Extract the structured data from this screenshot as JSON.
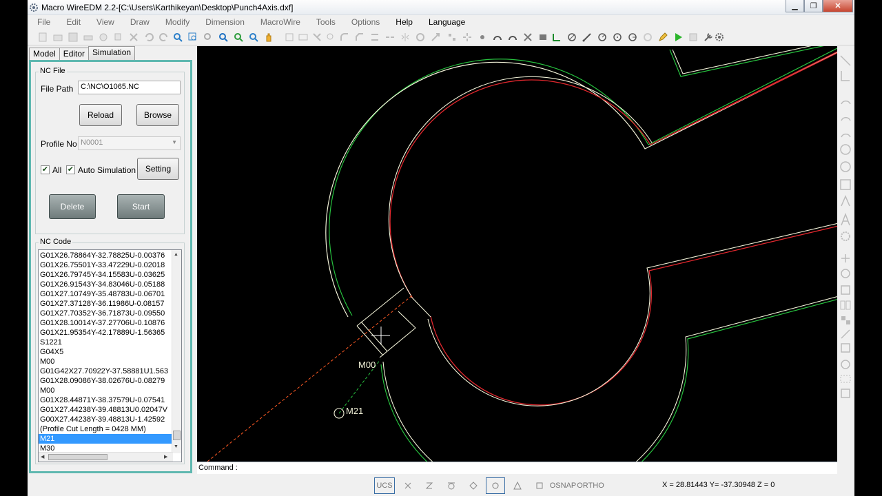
{
  "window": {
    "title": "Macro WireEDM 2.2-[C:\\Users\\Karthikeyan\\Desktop\\Punch4Axis.dxf]",
    "minimize": "▁",
    "restore": "❐",
    "close": "✕"
  },
  "menu": [
    "File",
    "Edit",
    "View",
    "Draw",
    "Modify",
    "Dimension",
    "MacroWire",
    "Tools",
    "Options",
    "Help",
    "Language"
  ],
  "tabs": {
    "model": "Model",
    "editor": "Editor",
    "simulation": "Simulation"
  },
  "nc_file": {
    "group_title": "NC File",
    "file_path_label": "File Path",
    "file_path_value": "C:\\NC\\O1065.NC",
    "reload": "Reload",
    "browse": "Browse",
    "profile_no_label": "Profile No",
    "profile_no_value": "N0001",
    "all_label": "All",
    "auto_sim_label": "Auto Simulation",
    "setting": "Setting",
    "delete": "Delete",
    "start": "Start"
  },
  "nc_code": {
    "group_title": "NC Code",
    "lines": [
      "G01X26.78864Y-32.78825U-0.00376",
      "G01X26.75501Y-33.47229U-0.02018",
      "G01X26.79745Y-34.15583U-0.03625",
      "G01X26.91543Y-34.83046U-0.05188",
      "G01X27.10749Y-35.48783U-0.06701",
      "G01X27.37128Y-36.11986U-0.08157",
      "G01X27.70352Y-36.71873U-0.09550",
      "G01X28.10014Y-37.27706U-0.10876",
      "G01X21.95354Y-42.17889U-1.56365",
      "S1221",
      "G04X5",
      "M00",
      "G01G42X27.70922Y-37.58881U1.563",
      "G01X28.09086Y-38.02676U-0.08279",
      "M00",
      "G01X28.44871Y-38.37579U-0.07541",
      "G01X27.44238Y-39.48813U0.02047V",
      "G00X27.44238Y-39.48813U-1.42592",
      "(Profile Cut Length = 0428 MM)",
      "M21",
      "M30"
    ],
    "selected_index": 19
  },
  "canvas": {
    "text_m00": "M00",
    "text_m21": "M21"
  },
  "command": {
    "label": "Command :"
  },
  "status": {
    "ucs": "UCS",
    "osnap": "OSNAP",
    "ortho": "ORTHO",
    "coords": "X = 28.81443  Y= -37.30948  Z = 0"
  },
  "colors": {
    "accent": "#5fb8b0",
    "selection": "#3399ff",
    "profile_red": "#e0272d",
    "profile_green": "#27c23f",
    "profile_white": "#f2f2d8",
    "lead_orange": "#ff5a24"
  }
}
